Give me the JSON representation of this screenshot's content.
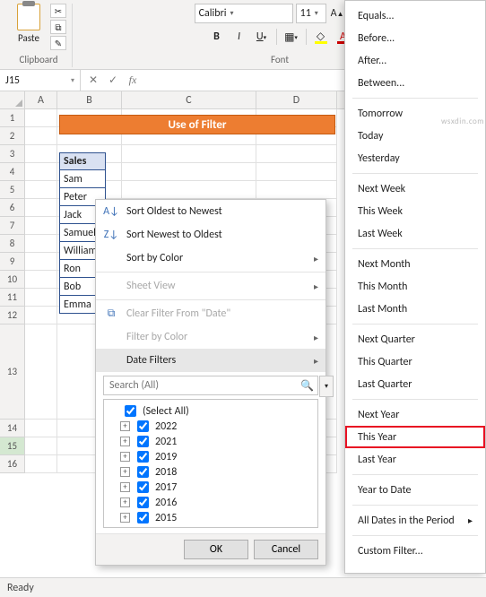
{
  "ribbon": {
    "paste_label": "Paste",
    "clipboard_label": "Clipboard",
    "font_label": "Font",
    "font_name": "Calibri",
    "font_size": "11",
    "bold": "B",
    "italic": "I",
    "underline": "U"
  },
  "namebox": {
    "ref": "J15",
    "fx": "fx"
  },
  "columns": {
    "A": "A",
    "B": "B",
    "C": "C",
    "D": "D"
  },
  "rows": [
    "1",
    "2",
    "3",
    "4",
    "5",
    "6",
    "7",
    "8",
    "9",
    "10",
    "11",
    "12",
    "13",
    "14",
    "15",
    "16"
  ],
  "banner": "Use of Filter",
  "table": {
    "header": "Sales",
    "names": [
      "Sam",
      "Peter",
      "Jack",
      "Samuel",
      "William",
      "Ron",
      "Bob",
      "Emma"
    ]
  },
  "ctx": {
    "sort_az": "Sort Oldest to Newest",
    "sort_za": "Sort Newest to Oldest",
    "sort_color": "Sort by Color",
    "sheet_view": "Sheet View",
    "clear": "Clear Filter From \"Date\"",
    "filter_color": "Filter by Color",
    "date_filters": "Date Filters",
    "search_ph": "Search (All)",
    "select_all": "(Select All)",
    "years": [
      "2022",
      "2021",
      "2019",
      "2018",
      "2017",
      "2016",
      "2015"
    ],
    "ok": "OK",
    "cancel": "Cancel"
  },
  "submenu": {
    "items1": [
      "Equals...",
      "Before...",
      "After...",
      "Between..."
    ],
    "items2": [
      "Tomorrow",
      "Today",
      "Yesterday"
    ],
    "items3": [
      "Next Week",
      "This Week",
      "Last Week"
    ],
    "items4": [
      "Next Month",
      "This Month",
      "Last Month"
    ],
    "items5": [
      "Next Quarter",
      "This Quarter",
      "Last Quarter"
    ],
    "items6": [
      "Next Year",
      "This Year",
      "Last Year"
    ],
    "ytd": "Year to Date",
    "all_period": "All Dates in the Period",
    "custom": "Custom Filter..."
  },
  "status": "Ready",
  "watermark": "wsxdin.com"
}
